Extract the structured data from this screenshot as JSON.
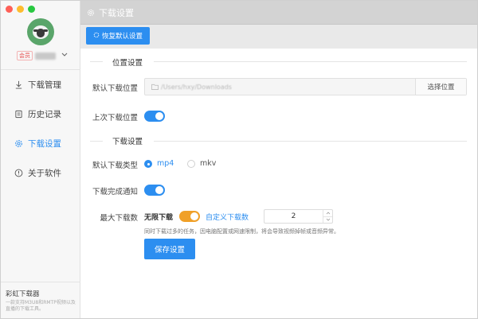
{
  "sidebar": {
    "user": {
      "vip_badge": "会员",
      "username": "••••"
    },
    "items": [
      {
        "label": "下载管理",
        "icon": "download-icon"
      },
      {
        "label": "历史记录",
        "icon": "history-icon"
      },
      {
        "label": "下载设置",
        "icon": "settings-icon",
        "active": true
      },
      {
        "label": "关于软件",
        "icon": "info-icon"
      }
    ],
    "footer": {
      "app_name": "彩虹下载器",
      "description": "一款支持M3U8和RMTP视频以及直播的下载工具。"
    }
  },
  "titlebar": {
    "title": "下载设置"
  },
  "toolbar": {
    "reset_label": "恢复默认设置"
  },
  "location_section": {
    "title": "位置设置",
    "default_location_label": "默认下载位置",
    "path_value": "/Users/hxy/Downloads",
    "choose_button": "选择位置",
    "last_location_label": "上次下载位置",
    "last_location_enabled": true
  },
  "download_section": {
    "title": "下载设置",
    "type_label": "默认下载类型",
    "type_options": [
      "mp4",
      "mkv"
    ],
    "type_selected": "mp4",
    "notify_label": "下载完成通知",
    "notify_enabled": true,
    "max_label": "最大下载数",
    "unlimited_label": "无限下载",
    "custom_label": "自定义下载数",
    "max_value": "2",
    "hint": "同时下载过多的任务，因电脑配置或网速限制，将会导致视频掉帧或音频异常。",
    "save_button": "保存设置"
  },
  "colors": {
    "accent": "#2c8ef0",
    "toggle_orange": "#f0a028"
  }
}
